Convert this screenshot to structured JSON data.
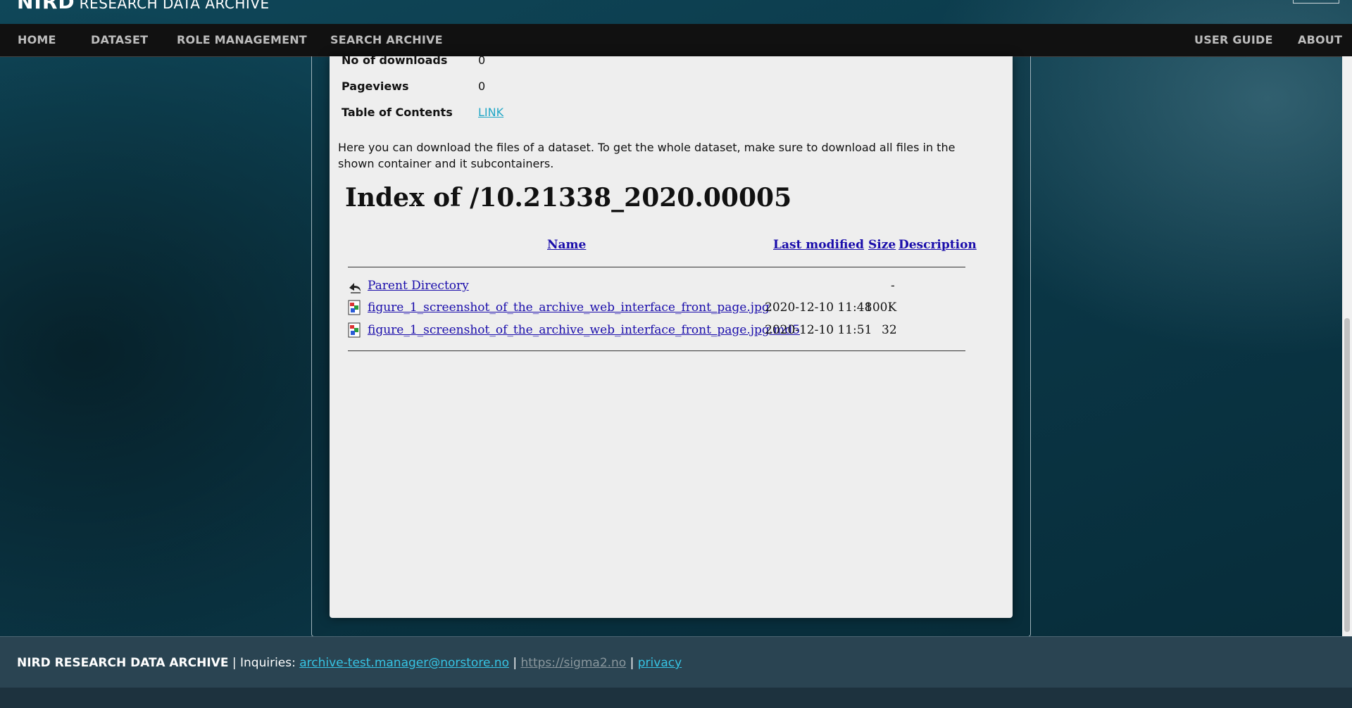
{
  "brand": {
    "part1": "NIRD",
    "part2": "RESEARCH DATA ARCHIVE"
  },
  "nav": {
    "left": [
      "HOME",
      "DATASET",
      "ROLE MANAGEMENT",
      "SEARCH ARCHIVE"
    ],
    "right": [
      "USER GUIDE",
      "ABOUT"
    ]
  },
  "meta": {
    "downloads_label": "No of downloads",
    "downloads_value": "0",
    "pageviews_label": "Pageviews",
    "pageviews_value": "0",
    "toc_label": "Table of Contents",
    "toc_link": "LINK"
  },
  "intro": "Here you can download the files of a dataset. To get the whole dataset, make sure to download all files in the shown container and it subcontainers.",
  "index": {
    "title": "Index of /10.21338_2020.00005",
    "headers": {
      "name": "Name",
      "modified": "Last modified",
      "size": "Size",
      "description": "Description"
    },
    "parent": {
      "name": "Parent Directory",
      "size": "-"
    },
    "files": [
      {
        "name": "figure_1_screenshot_of_the_archive_web_interface_front_page.jpg",
        "modified": "2020-12-10 11:48",
        "size": "100K"
      },
      {
        "name": "figure_1_screenshot_of_the_archive_web_interface_front_page.jpg.md5",
        "modified": "2020-12-10 11:51",
        "size": "32"
      }
    ]
  },
  "footer": {
    "brand": "NIRD RESEARCH DATA ARCHIVE",
    "sep1": " | ",
    "inquiries": "Inquiries: ",
    "email": "archive-test.manager@norstore.no",
    "sep2": " | ",
    "site": "https://sigma2.no",
    "sep3": " | ",
    "privacy": "privacy"
  },
  "colors": {
    "nav_bg": "#111111",
    "panel_bg": "#eeeeee",
    "footer_bg": "#2a4452",
    "link_accent": "#36c4e4",
    "index_link": "#1a0dab"
  },
  "icons": {
    "parent": "back-arrow-icon",
    "file": "image-file-icon"
  }
}
